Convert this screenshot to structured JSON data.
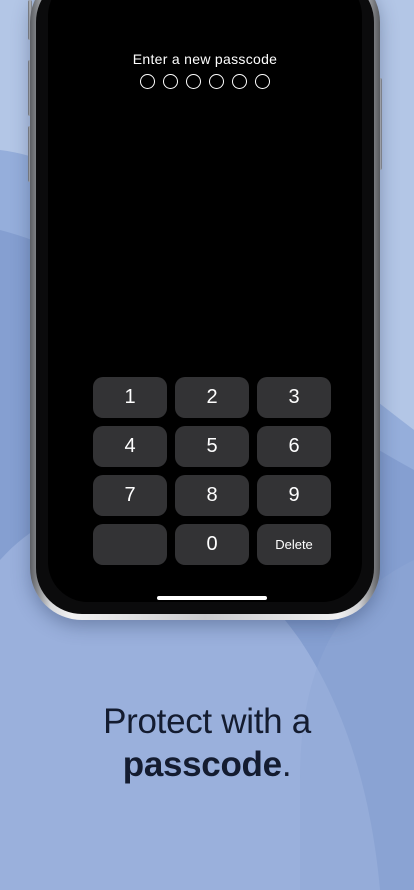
{
  "passcode_screen": {
    "prompt": "Enter a new passcode",
    "digits_total": 6,
    "digits_entered": 0
  },
  "keypad": {
    "keys": [
      "1",
      "2",
      "3",
      "4",
      "5",
      "6",
      "7",
      "8",
      "9",
      "",
      "0",
      "Delete"
    ]
  },
  "promo": {
    "line1": "Protect with a",
    "line2_bold": "passcode",
    "line2_suffix": "."
  },
  "colors": {
    "background": "#a9bfe0",
    "key": "#333335",
    "screen": "#000000",
    "headline": "#141c30"
  }
}
